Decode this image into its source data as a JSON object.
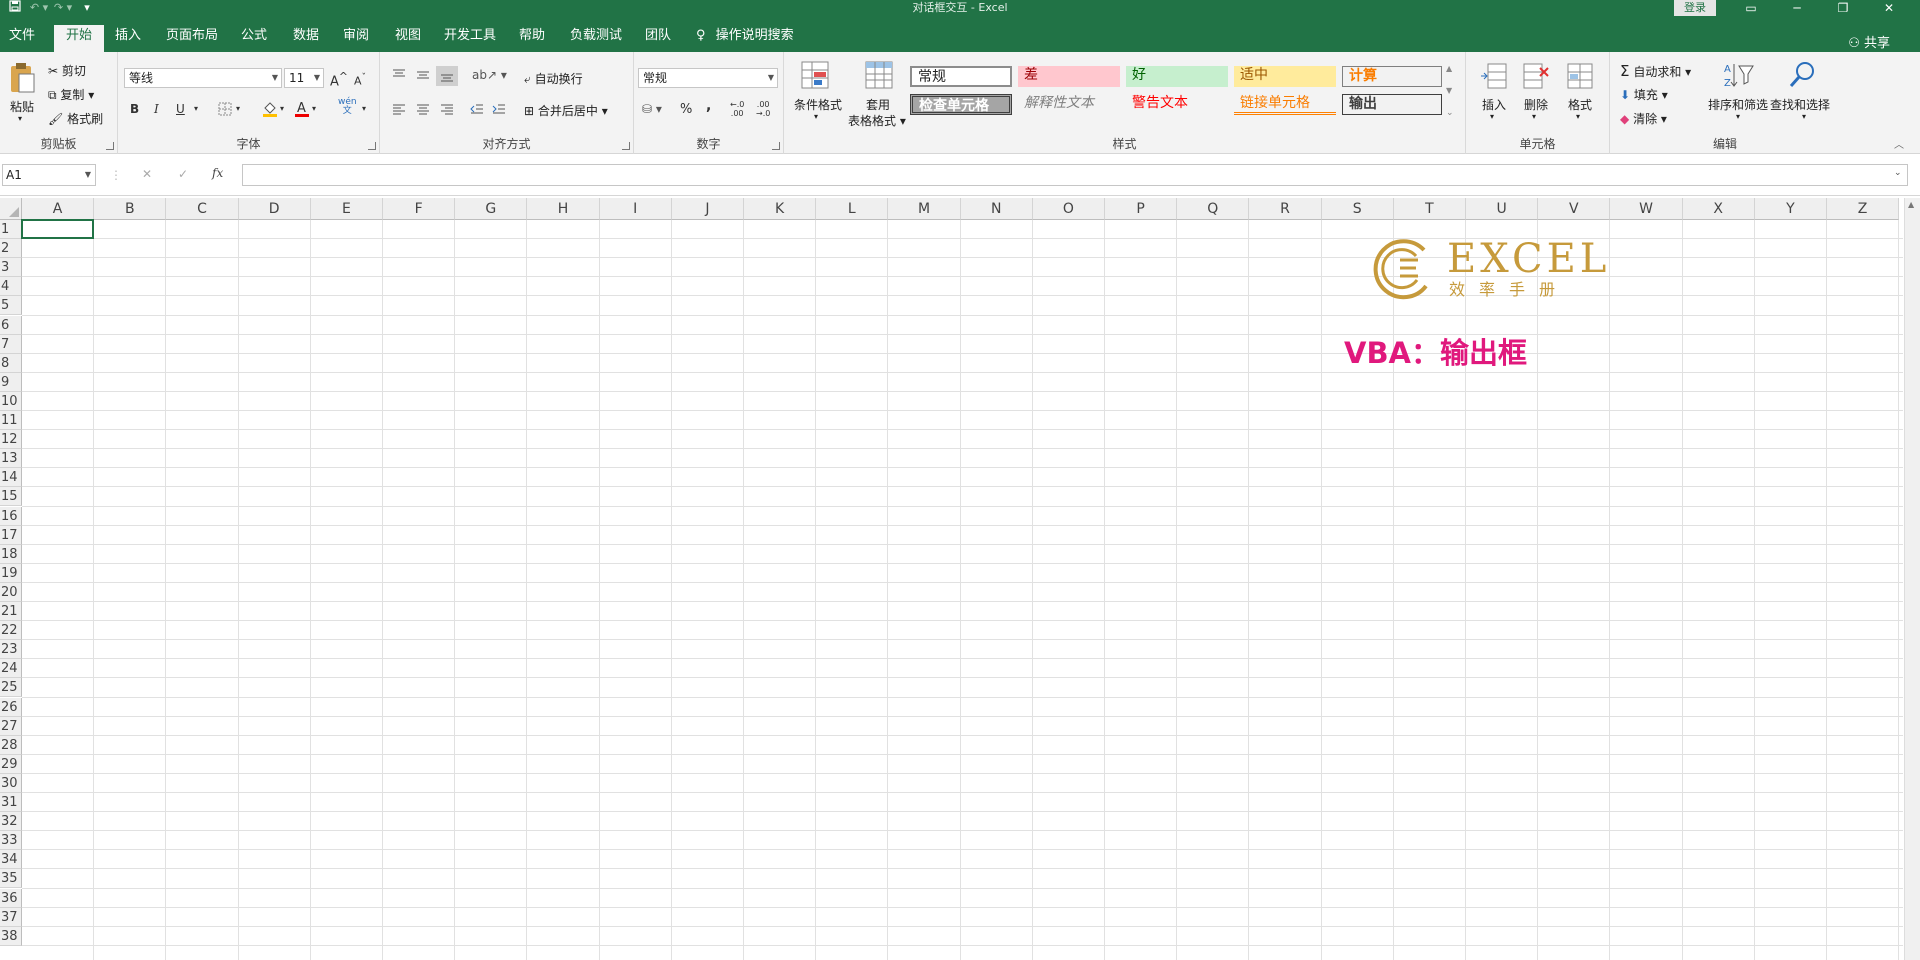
{
  "window": {
    "title": "对话框交互  -  Excel",
    "login": "登录",
    "share": "共享"
  },
  "tabs": [
    "文件",
    "开始",
    "插入",
    "页面布局",
    "公式",
    "数据",
    "审阅",
    "视图",
    "开发工具",
    "帮助",
    "负载测试",
    "团队"
  ],
  "tell_me": "操作说明搜索",
  "ribbon": {
    "clipboard": {
      "label": "剪贴板",
      "paste": "粘贴",
      "cut": "剪切",
      "copy": "复制",
      "format_painter": "格式刷"
    },
    "font": {
      "label": "字体",
      "family": "等线",
      "size": "11",
      "bold": "B",
      "italic": "I",
      "underline": "U",
      "grow": "A",
      "shrink": "A",
      "font_color": "A",
      "phonetic": "wén\n文"
    },
    "alignment": {
      "label": "对齐方式",
      "wrap": "自动换行",
      "merge": "合并后居中"
    },
    "number": {
      "label": "数字",
      "format": "常规",
      "percent": "%",
      "comma": ",",
      "inc": "←.0\n.00",
      "dec": ".00\n→.0"
    },
    "styles": {
      "label": "样式",
      "conditional": "条件格式",
      "table_line1": "套用",
      "table_line2": "表格格式",
      "cells": [
        {
          "text": "常规"
        },
        {
          "text": "差"
        },
        {
          "text": "好"
        },
        {
          "text": "适中"
        },
        {
          "text": "计算"
        },
        {
          "text": "检查单元格"
        },
        {
          "text": "解释性文本"
        },
        {
          "text": "警告文本"
        },
        {
          "text": "链接单元格"
        },
        {
          "text": "输出"
        }
      ]
    },
    "cells_group": {
      "label": "单元格",
      "insert": "插入",
      "delete": "删除",
      "format": "格式"
    },
    "editing": {
      "label": "编辑",
      "autosum": "自动求和",
      "fill": "填充",
      "clear": "清除",
      "sort": "排序和筛选",
      "find": "查找和选择"
    }
  },
  "formula_bar": {
    "name_box": "A1",
    "cancel": "✕",
    "enter": "✓",
    "fx": "fx",
    "value": ""
  },
  "sheet": {
    "columns": [
      "A",
      "B",
      "C",
      "D",
      "E",
      "F",
      "G",
      "H",
      "I",
      "J",
      "K",
      "L",
      "M",
      "N",
      "O",
      "P",
      "Q",
      "R",
      "S",
      "T",
      "U",
      "V",
      "W",
      "X",
      "Y",
      "Z"
    ],
    "rows": [
      "1",
      "2",
      "3",
      "4",
      "5",
      "6",
      "7",
      "8",
      "9",
      "10",
      "11",
      "12",
      "13",
      "14",
      "15",
      "16",
      "17",
      "18",
      "19",
      "20",
      "21",
      "22",
      "23",
      "24",
      "25",
      "26",
      "27",
      "28",
      "29",
      "30",
      "31",
      "32",
      "33",
      "34",
      "35",
      "36",
      "37",
      "38"
    ]
  },
  "overlay": {
    "logo_text": "EXCEL",
    "logo_sub": "效率手册",
    "title": "VBA：输出框",
    "title_color": "#e0197d",
    "logo_color": "#c69a3b"
  },
  "colors": {
    "accent": "#217346"
  }
}
